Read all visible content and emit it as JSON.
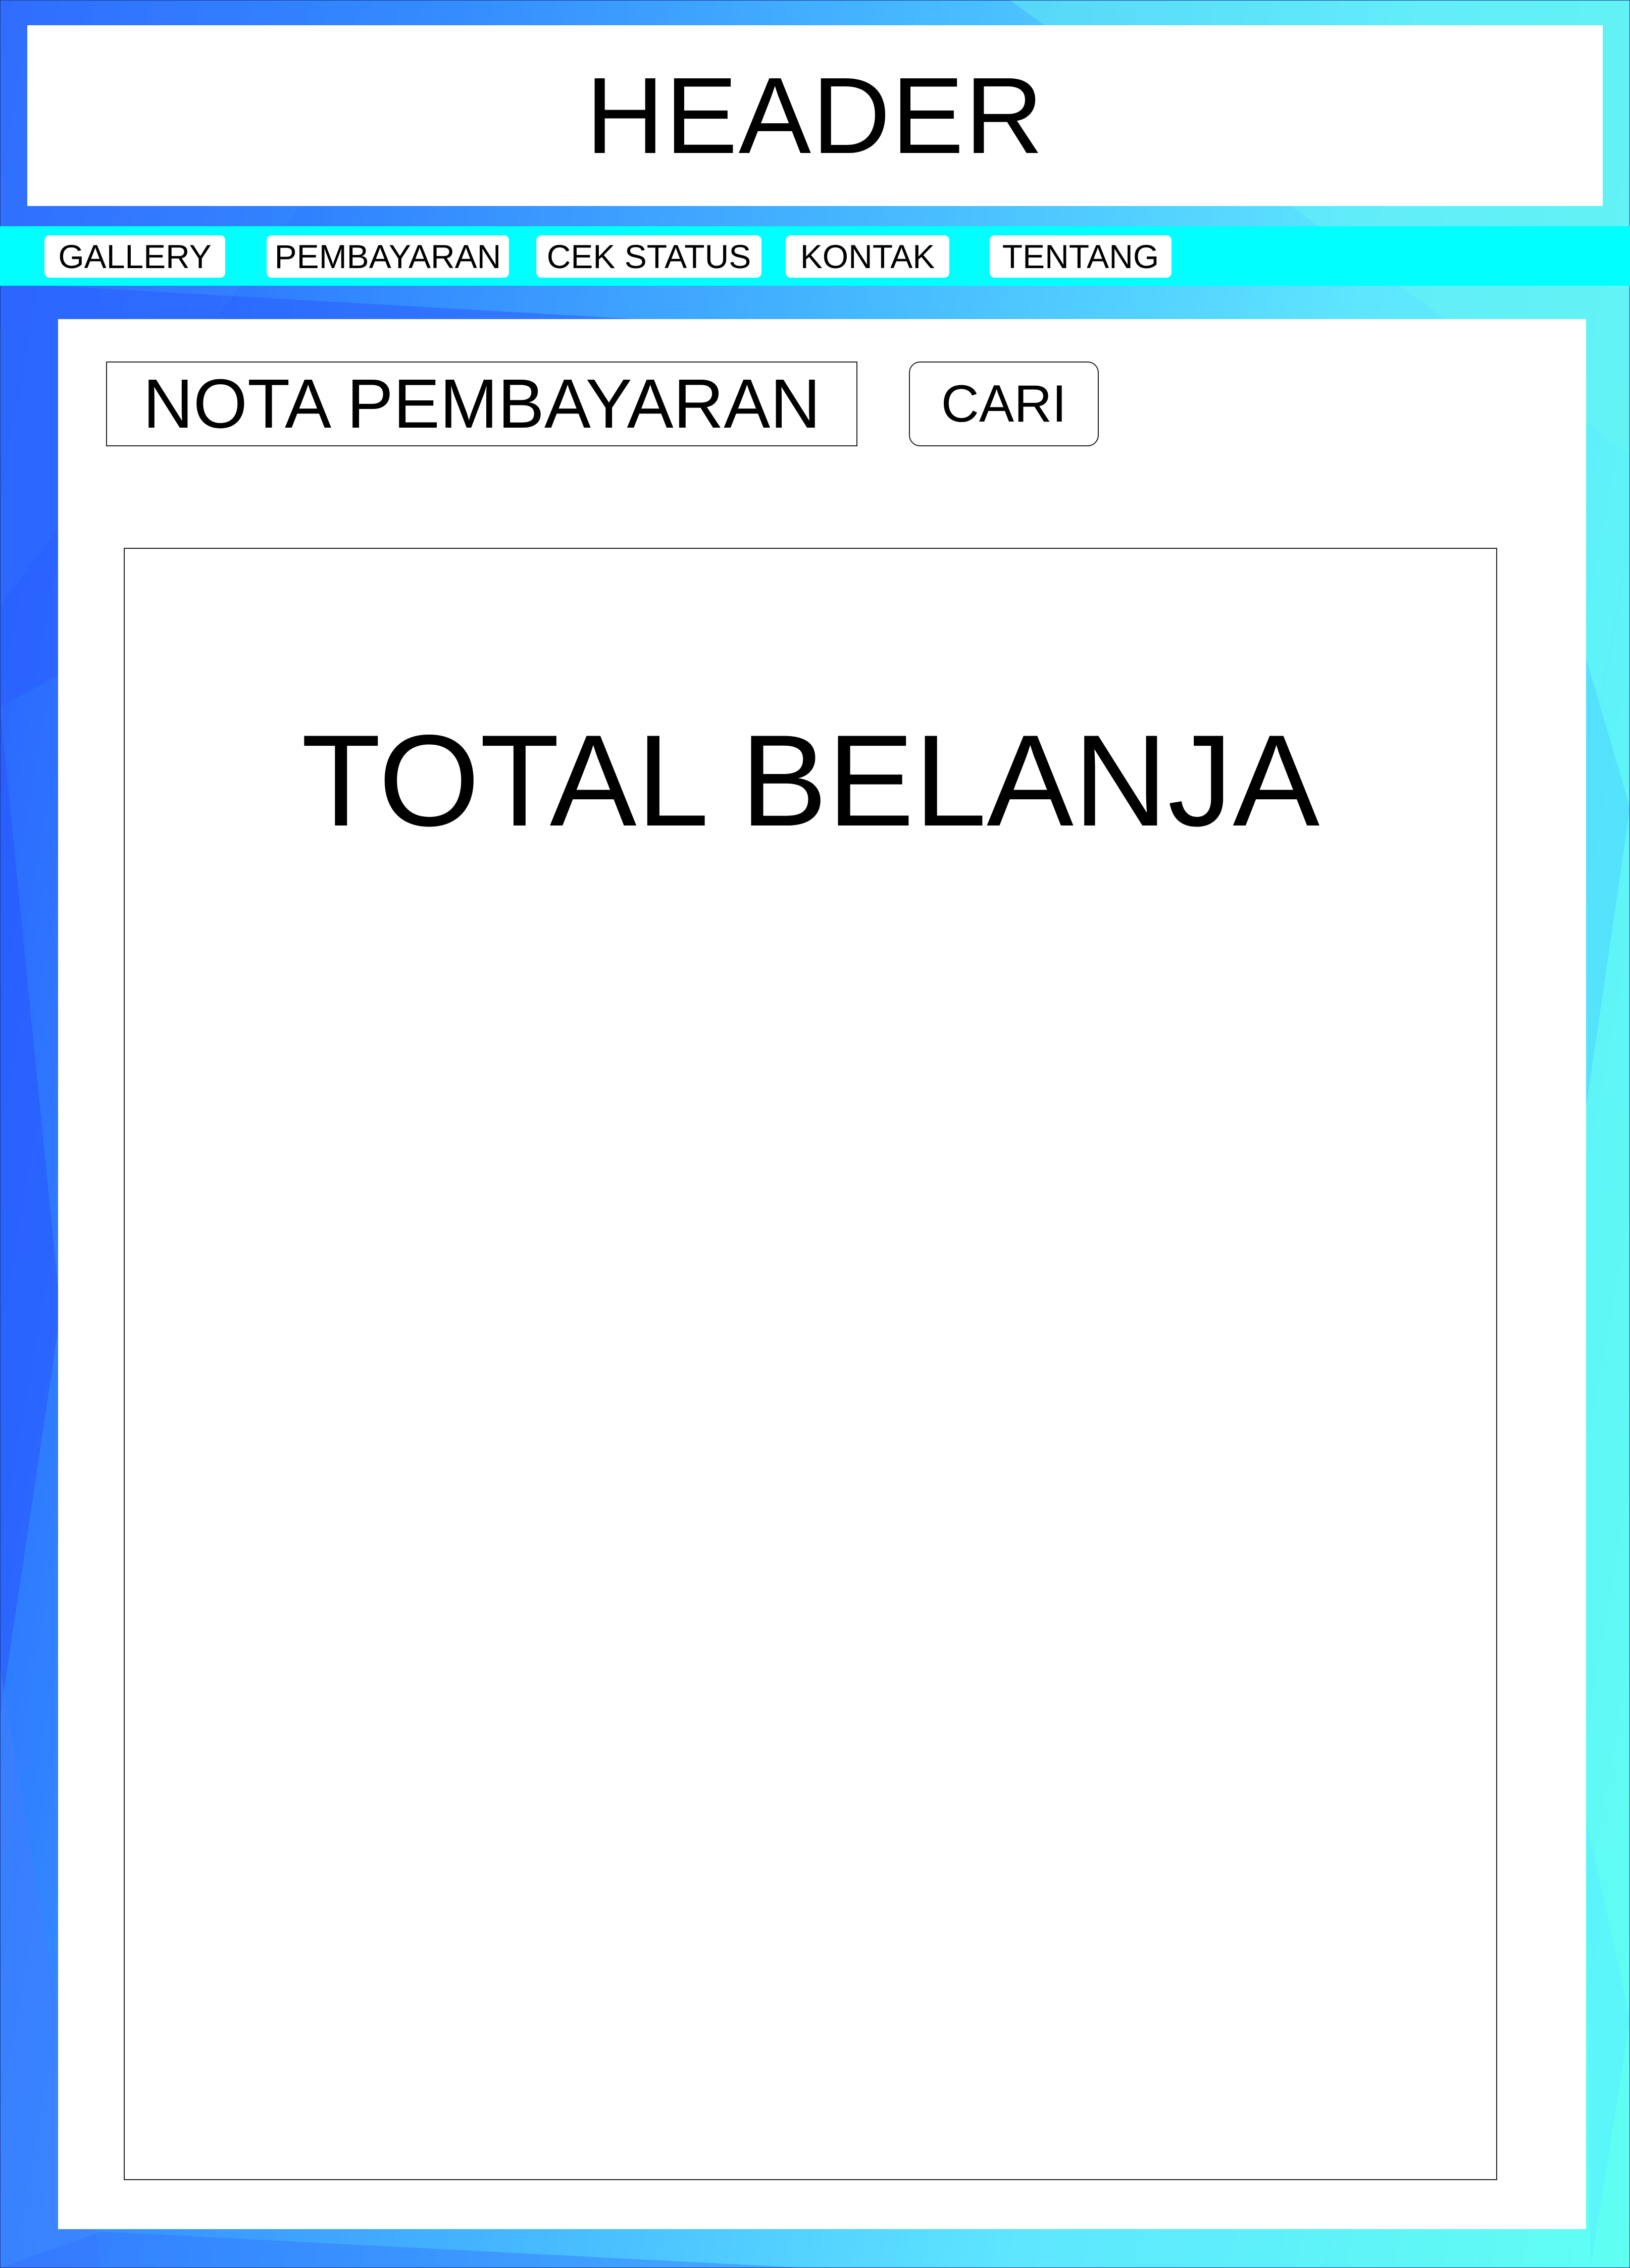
{
  "header": {
    "title": "HEADER"
  },
  "nav": {
    "items": [
      {
        "label": "GALLERY"
      },
      {
        "label": "PEMBAYARAN"
      },
      {
        "label": "CEK STATUS"
      },
      {
        "label": "KONTAK"
      },
      {
        "label": "TENTANG"
      }
    ]
  },
  "search": {
    "field_value": "NOTA PEMBAYARAN",
    "button_label": "CARI"
  },
  "receipt": {
    "title": "TOTAL BELANJA"
  },
  "colors": {
    "background_blue": "#2a5cff",
    "background_cyan": "#5ffff2",
    "nav_strip": "#00ffff",
    "panel": "#ffffff"
  }
}
